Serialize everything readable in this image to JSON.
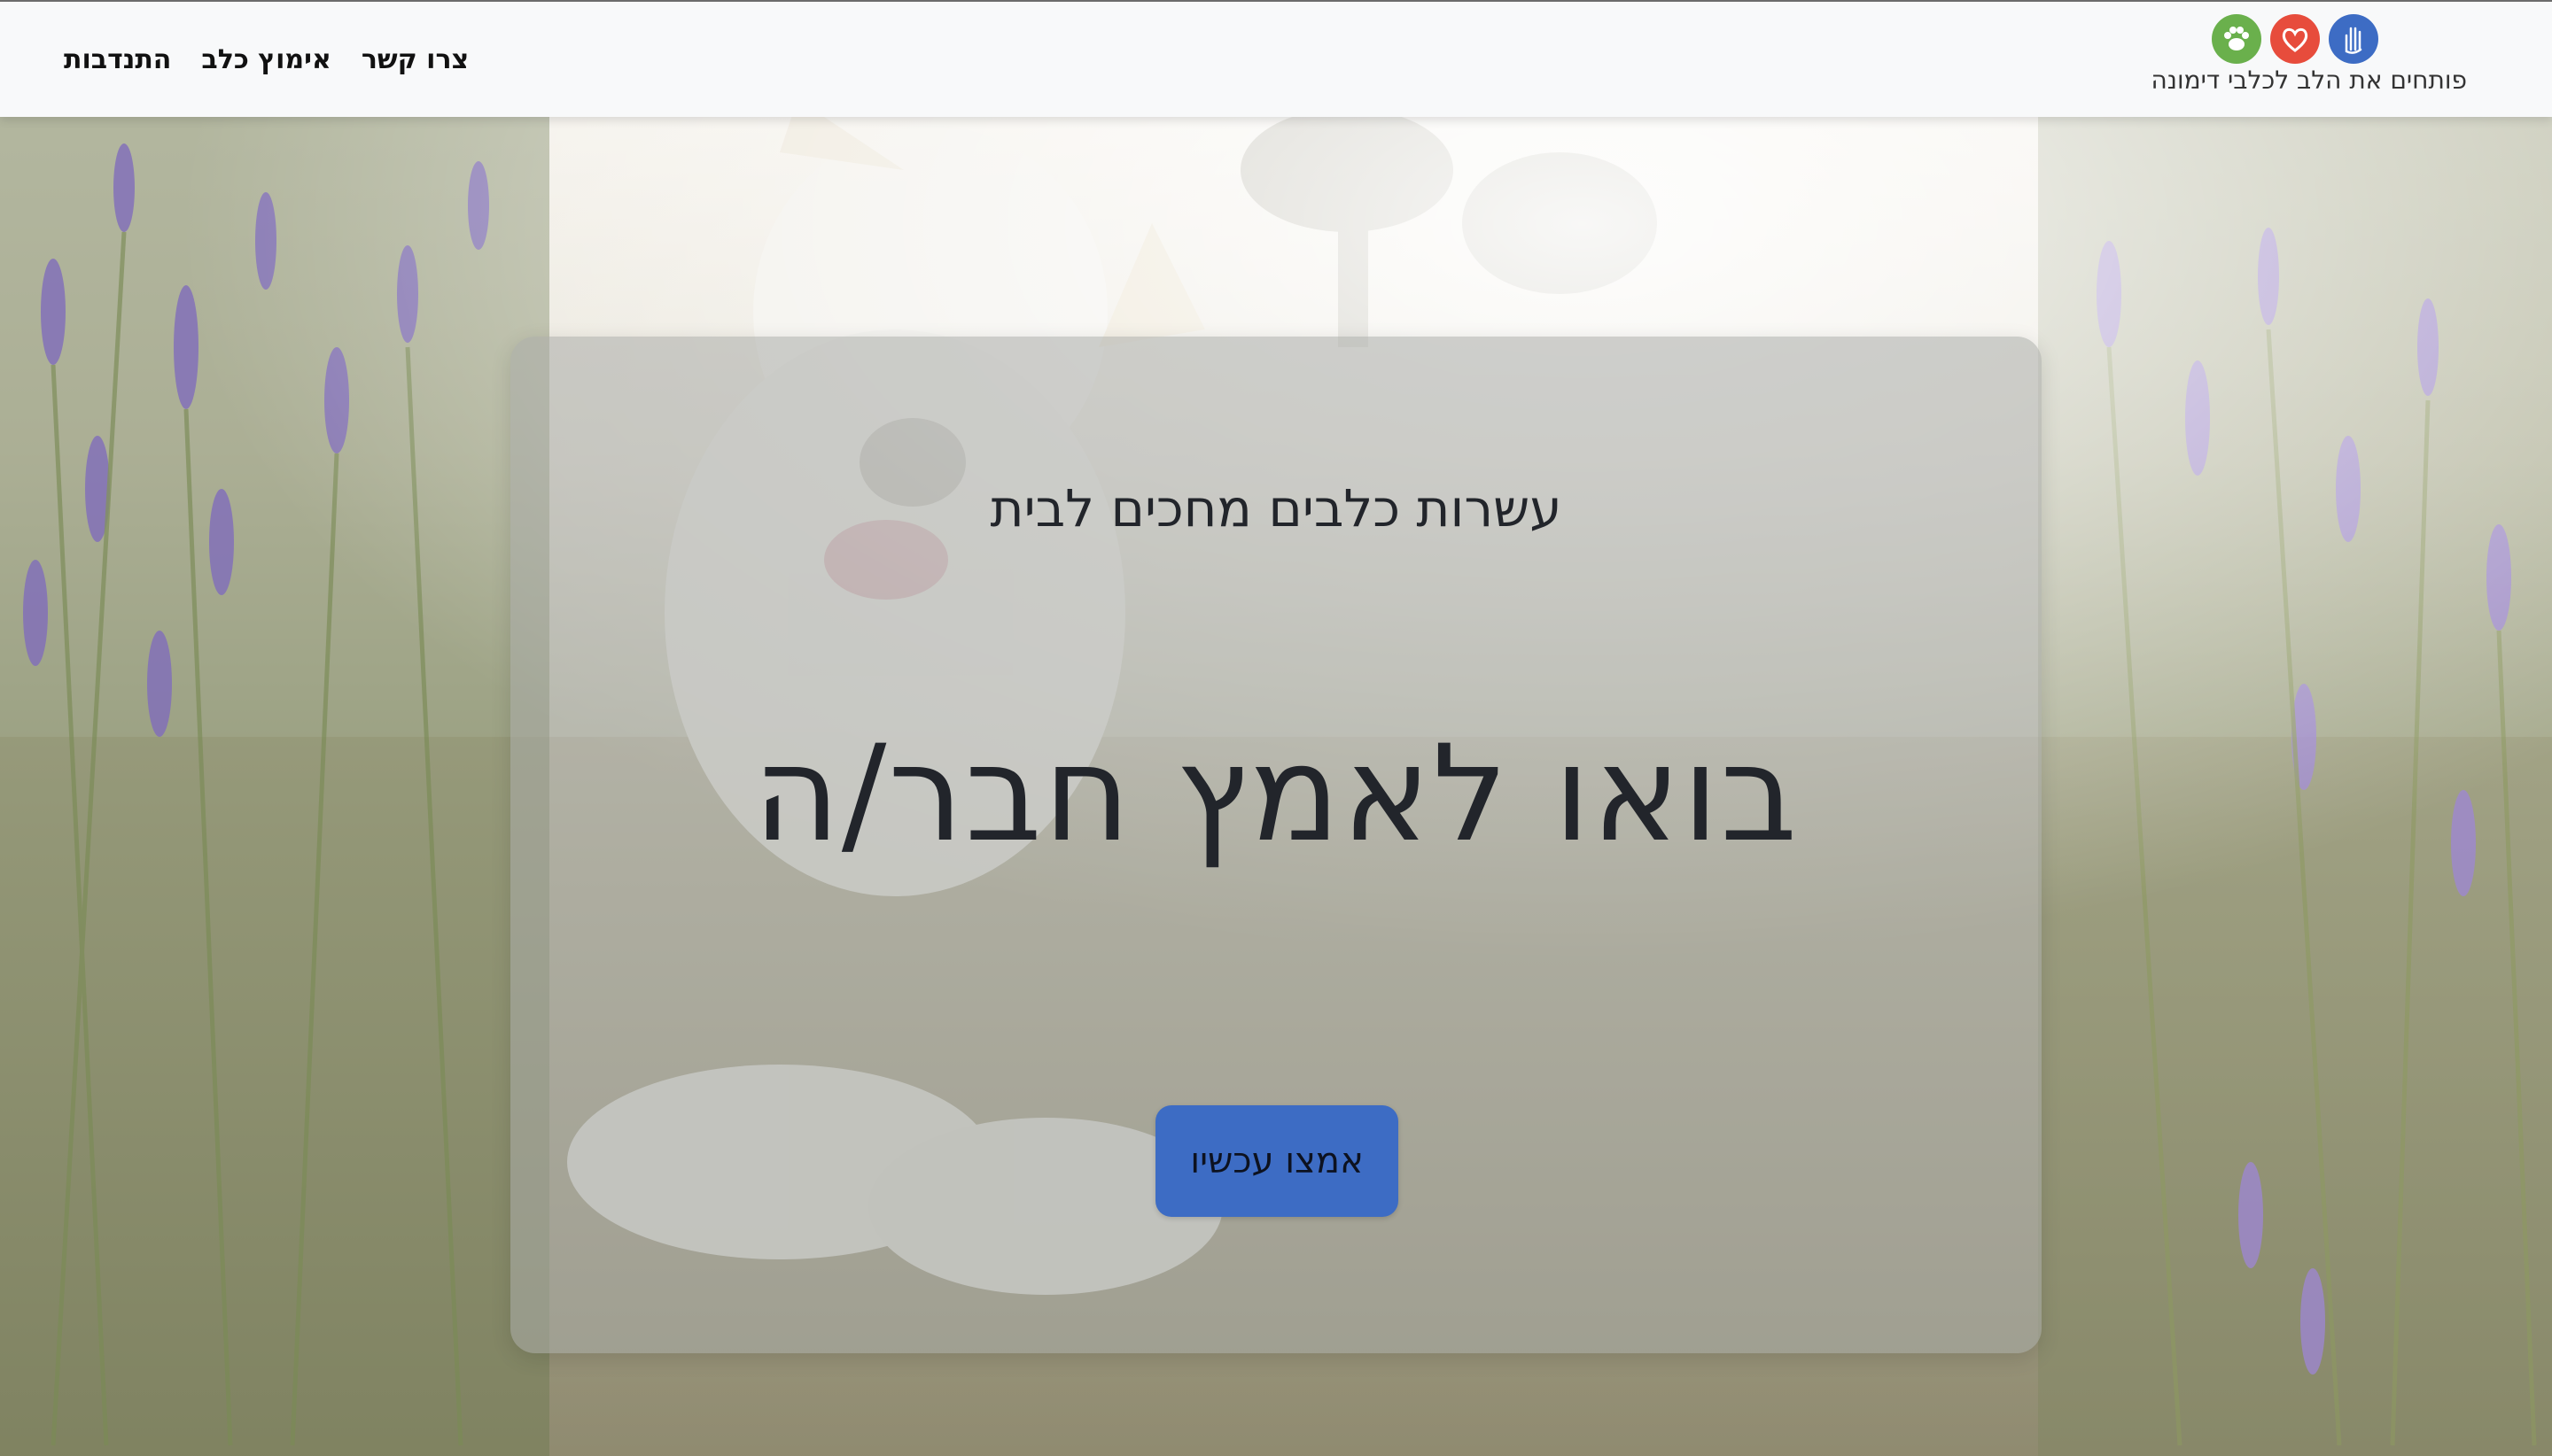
{
  "nav": {
    "links": [
      "התנדבות",
      "אימוץ כלב",
      "צרו קשר"
    ]
  },
  "brand": {
    "text": "פותחים את הלב לכלבי דימונה",
    "icons": [
      {
        "name": "paw-icon",
        "color": "#6ab04c"
      },
      {
        "name": "heart-icon",
        "color": "#e74c3c"
      },
      {
        "name": "hand-icon",
        "color": "#3d6cc4"
      }
    ]
  },
  "hero": {
    "subtitle": "עשרות כלבים מחכים לבית",
    "title": "בואו לאמץ חבר/ה",
    "button_label": "אמצו עכשיו"
  }
}
